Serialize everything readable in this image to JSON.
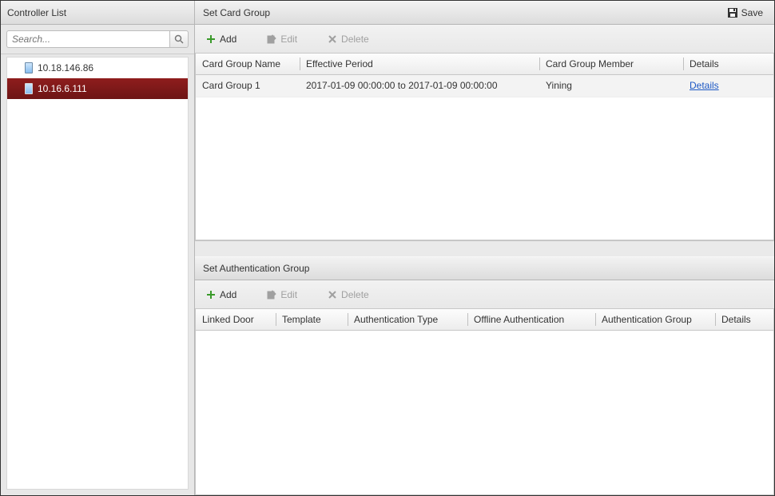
{
  "sidebar": {
    "title": "Controller List",
    "search_placeholder": "Search...",
    "items": [
      {
        "label": "10.18.146.86",
        "selected": false
      },
      {
        "label": "10.16.6.111",
        "selected": true
      }
    ]
  },
  "card_group": {
    "title": "Set Card Group",
    "save_label": "Save",
    "toolbar": {
      "add": "Add",
      "edit": "Edit",
      "delete": "Delete"
    },
    "columns": {
      "name": "Card Group Name",
      "period": "Effective Period",
      "member": "Card Group Member",
      "details": "Details"
    },
    "rows": [
      {
        "name": "Card Group 1",
        "period": "2017-01-09 00:00:00 to 2017-01-09 00:00:00",
        "member": "Yining",
        "details": "Details"
      }
    ]
  },
  "auth_group": {
    "title": "Set Authentication Group",
    "toolbar": {
      "add": "Add",
      "edit": "Edit",
      "delete": "Delete"
    },
    "columns": {
      "door": "Linked Door",
      "template": "Template",
      "auth_type": "Authentication Type",
      "offline": "Offline Authentication",
      "group": "Authentication Group",
      "details": "Details"
    },
    "rows": []
  }
}
